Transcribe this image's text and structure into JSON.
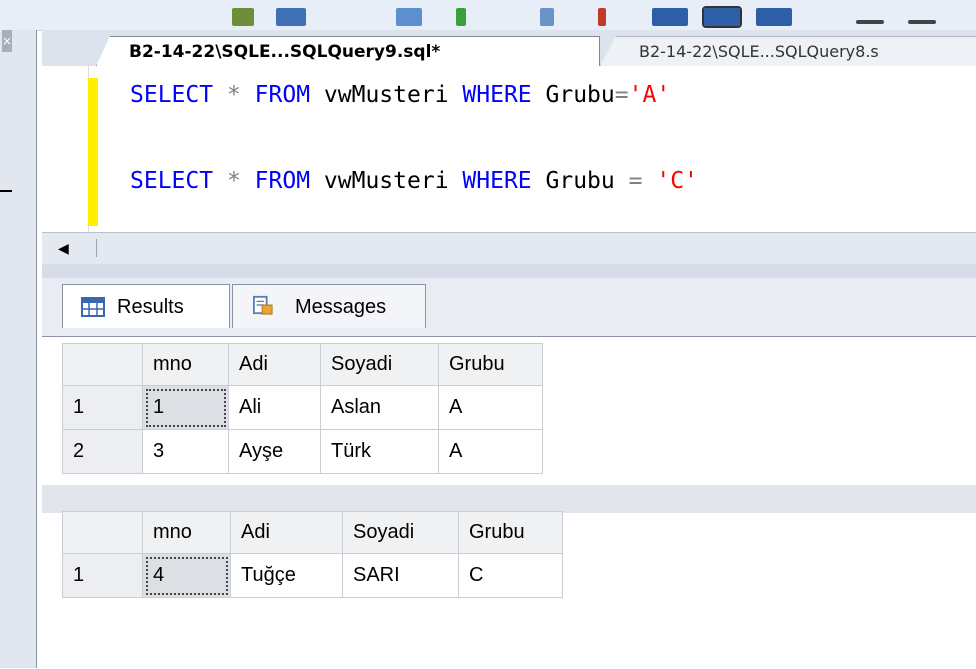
{
  "editor_tabs": [
    {
      "label": "B2-14-22\\SQLE...SQLQuery9.sql*",
      "active": true
    },
    {
      "label": "B2-14-22\\SQLE...SQLQuery8.s",
      "active": false
    }
  ],
  "code": {
    "line1": {
      "kw1": "SELECT",
      "star": "*",
      "kw2": "FROM",
      "view": "vwMusteri",
      "kw3": "WHERE",
      "col": "Grubu",
      "op": "=",
      "str": "'A'"
    },
    "line2": {
      "kw1": "SELECT",
      "star": "*",
      "kw2": "FROM",
      "view": "vwMusteri",
      "kw3": "WHERE",
      "col": "Grubu",
      "op": "=",
      "str": "'C'"
    }
  },
  "result_tabs": {
    "results": "Results",
    "messages": "Messages"
  },
  "grid1": {
    "columns": [
      "mno",
      "Adi",
      "Soyadi",
      "Grubu"
    ],
    "rows": [
      {
        "n": "1",
        "mno": "1",
        "adi": "Ali",
        "soyadi": "Aslan",
        "grubu": "A"
      },
      {
        "n": "2",
        "mno": "3",
        "adi": "Ayşe",
        "soyadi": "Türk",
        "grubu": "A"
      }
    ]
  },
  "grid2": {
    "columns": [
      "mno",
      "Adi",
      "Soyadi",
      "Grubu"
    ],
    "rows": [
      {
        "n": "1",
        "mno": "4",
        "adi": "Tuğçe",
        "soyadi": "SARI",
        "grubu": "C"
      }
    ]
  },
  "colors": {
    "keyword": "#0000ff",
    "string": "#ff0000",
    "operator": "#808080",
    "change_marker": "#ffef00"
  }
}
